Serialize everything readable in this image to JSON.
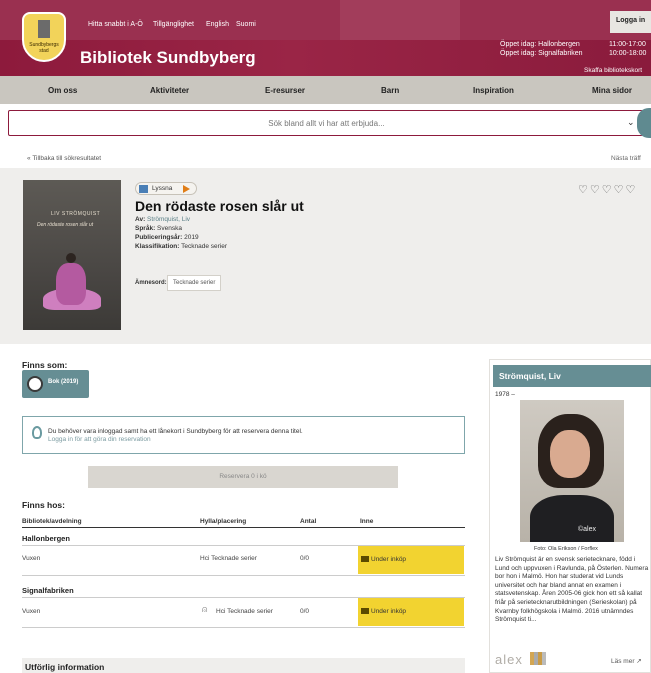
{
  "header": {
    "logo_text": "Sundbybergs stad",
    "toplinks": [
      "Hitta snabbt i A-Ö",
      "Tillgänglighet",
      "English",
      "Suomi"
    ],
    "site_title": "Bibliotek Sundbyberg",
    "login_label": "Logga in",
    "hours": [
      {
        "label": "Öppet idag: Hallonbergen",
        "time": "11:00-17:00"
      },
      {
        "label": "Öppet idag: Signalfabriken",
        "time": "10:00-18:00"
      }
    ],
    "card_link": "Skaffa bibliotekskort"
  },
  "nav": [
    "Om oss",
    "Aktiviteter",
    "E-resurser",
    "Barn",
    "Inspiration",
    "Mina sidor"
  ],
  "search": {
    "placeholder": "Sök bland allt vi har att erbjuda..."
  },
  "back_link": "Tillbaka till sökresultatet",
  "next_link": "Nästa träff",
  "book": {
    "cover_author": "LIV STRÖMQUIST",
    "cover_title": "Den rödaste rosen slår ut",
    "listen_label": "Lyssna",
    "title": "Den rödaste rosen slår ut",
    "author_label": "Av:",
    "author": "Strömquist, Liv",
    "language_label": "Språk:",
    "language": "Svenska",
    "year_label": "Publiceringsår:",
    "year": "2019",
    "classification_label": "Klassifikation:",
    "classification": "Tecknade serier",
    "subject_label": "Ämnesord:",
    "subject": "Tecknade serier",
    "hearts": "♡♡♡♡♡"
  },
  "formats": {
    "heading": "Finns som:",
    "items": [
      {
        "label": "Bok (2019)"
      }
    ]
  },
  "notice": {
    "line1": "Du behöver vara inloggad samt ha ett lånekort i Sundbyberg för att reservera denna titel.",
    "line2": "Logga in för att göra din reservation"
  },
  "reserve_label": "Reservera 0 i kö",
  "holdings": {
    "heading": "Finns hos:",
    "columns": [
      "Bibliotek/avdelning",
      "Hylla/placering",
      "Antal",
      "Inne"
    ],
    "branches": [
      {
        "name": "Hallonbergen",
        "rows": [
          {
            "dept": "Vuxen",
            "shelf": "Hci Tecknade serier",
            "count": "0/0",
            "status": "Under inköp"
          }
        ]
      },
      {
        "name": "Signalfabriken",
        "rows": [
          {
            "dept": "Vuxen",
            "shelf": "Hci Tecknade serier",
            "count": "0/0",
            "status": "Under inköp"
          }
        ]
      }
    ]
  },
  "more_info_heading": "Utförlig information",
  "author_panel": {
    "name": "Strömquist, Liv",
    "years": "1978 –",
    "photo_watermark": "©alex",
    "photo_credit": "Foto: Ola Erikson / Forflex",
    "bio": "Liv Strömquist är en svensk serietecknare, född i Lund och uppvuxen i Ravlunda, på Österlen. Numera bor hon i Malmö. Hon har studerat vid Lunds universitet och har bland annat en examen i statsvetenskap. Åren 2005-06 gick hon ett så kallat friår på serietecknarutbildningen (Serieskolan) på Kvarnby folkhögskola i Malmö. 2016 utnämndes Strömquist ti...",
    "source_logo": "alex",
    "read_more": "Läs mer"
  },
  "colors": {
    "brand": "#8d1a3c",
    "teal": "#668e94",
    "status_yellow": "#f2d330"
  }
}
